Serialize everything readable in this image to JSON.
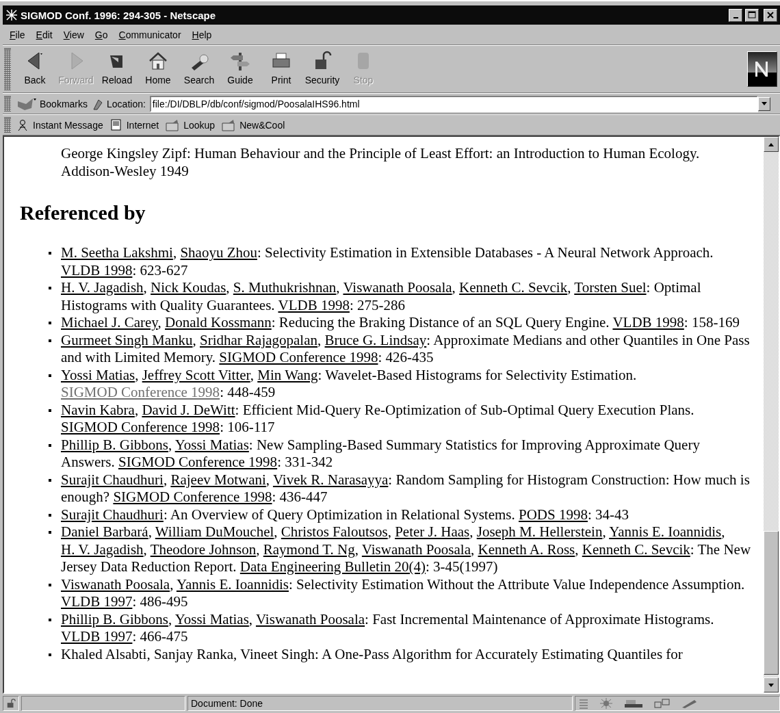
{
  "window": {
    "title": "SIGMOD Conf. 1996: 294-305 - Netscape"
  },
  "menu": [
    "File",
    "Edit",
    "View",
    "Go",
    "Communicator",
    "Help"
  ],
  "toolbar": [
    {
      "label": "Back",
      "kind": "back",
      "disabled": false
    },
    {
      "label": "Forward",
      "kind": "forward",
      "disabled": true
    },
    {
      "label": "Reload",
      "kind": "reload",
      "disabled": false
    },
    {
      "label": "Home",
      "kind": "home",
      "disabled": false
    },
    {
      "label": "Search",
      "kind": "search",
      "disabled": false
    },
    {
      "label": "Guide",
      "kind": "guide",
      "disabled": false
    },
    {
      "label": "Print",
      "kind": "print",
      "disabled": false
    },
    {
      "label": "Security",
      "kind": "security",
      "disabled": false
    },
    {
      "label": "Stop",
      "kind": "stop",
      "disabled": true
    }
  ],
  "location_bar": {
    "bookmarks": "Bookmarks",
    "label": "Location:",
    "value": "file:/DI/DBLP/db/conf/sigmod/PoosalaIHS96.html"
  },
  "personal_toolbar": [
    {
      "label": "Instant Message",
      "kind": "person"
    },
    {
      "label": "Internet",
      "kind": "page"
    },
    {
      "label": "Lookup",
      "kind": "folder"
    },
    {
      "label": "New&Cool",
      "kind": "folder"
    }
  ],
  "content": {
    "previous_reference": "George Kingsley Zipf: Human Behaviour and the Principle of Least Effort: an Introduction to Human Ecology. Addison-Wesley 1949",
    "heading": "Referenced by",
    "entries": [
      [
        {
          "kind": "link",
          "text": "M. Seetha Lakshmi"
        },
        {
          "kind": "text",
          "text": ", "
        },
        {
          "kind": "link",
          "text": "Shaoyu Zhou"
        },
        {
          "kind": "text",
          "text": ": Selectivity Estimation in Extensible Databases - A Neural Network Approach. "
        },
        {
          "kind": "link",
          "text": "VLDB 1998"
        },
        {
          "kind": "text",
          "text": ": 623-627"
        }
      ],
      [
        {
          "kind": "link",
          "text": "H. V. Jagadish"
        },
        {
          "kind": "text",
          "text": ", "
        },
        {
          "kind": "link",
          "text": "Nick Koudas"
        },
        {
          "kind": "text",
          "text": ", "
        },
        {
          "kind": "link",
          "text": "S. Muthukrishnan"
        },
        {
          "kind": "text",
          "text": ", "
        },
        {
          "kind": "link",
          "text": "Viswanath Poosala"
        },
        {
          "kind": "text",
          "text": ", "
        },
        {
          "kind": "link",
          "text": "Kenneth C. Sevcik"
        },
        {
          "kind": "text",
          "text": ", "
        },
        {
          "kind": "link",
          "text": "Torsten Suel"
        },
        {
          "kind": "text",
          "text": ": Optimal Histograms with Quality Guarantees. "
        },
        {
          "kind": "link",
          "text": "VLDB 1998"
        },
        {
          "kind": "text",
          "text": ": 275-286"
        }
      ],
      [
        {
          "kind": "link",
          "text": "Michael J. Carey"
        },
        {
          "kind": "text",
          "text": ", "
        },
        {
          "kind": "link",
          "text": "Donald Kossmann"
        },
        {
          "kind": "text",
          "text": ": Reducing the Braking Distance of an SQL Query Engine. "
        },
        {
          "kind": "link",
          "text": "VLDB 1998"
        },
        {
          "kind": "text",
          "text": ": 158-169"
        }
      ],
      [
        {
          "kind": "link",
          "text": "Gurmeet Singh Manku"
        },
        {
          "kind": "text",
          "text": ", "
        },
        {
          "kind": "link",
          "text": "Sridhar Rajagopalan"
        },
        {
          "kind": "text",
          "text": ", "
        },
        {
          "kind": "link",
          "text": "Bruce G. Lindsay"
        },
        {
          "kind": "text",
          "text": ": Approximate Medians and other Quantiles in One Pass and with Limited Memory. "
        },
        {
          "kind": "link",
          "text": "SIGMOD Conference 1998"
        },
        {
          "kind": "text",
          "text": ": 426-435"
        }
      ],
      [
        {
          "kind": "link",
          "text": "Yossi Matias"
        },
        {
          "kind": "text",
          "text": ", "
        },
        {
          "kind": "link",
          "text": "Jeffrey Scott Vitter"
        },
        {
          "kind": "text",
          "text": ", "
        },
        {
          "kind": "link",
          "text": "Min Wang"
        },
        {
          "kind": "text",
          "text": ": Wavelet-Based Histograms for Selectivity Estimation. "
        },
        {
          "kind": "visited",
          "text": "SIGMOD Conference 1998"
        },
        {
          "kind": "text",
          "text": ": 448-459"
        }
      ],
      [
        {
          "kind": "link",
          "text": "Navin Kabra"
        },
        {
          "kind": "text",
          "text": ", "
        },
        {
          "kind": "link",
          "text": "David J. DeWitt"
        },
        {
          "kind": "text",
          "text": ": Efficient Mid-Query Re-Optimization of Sub-Optimal Query Execution Plans. "
        },
        {
          "kind": "link",
          "text": "SIGMOD Conference 1998"
        },
        {
          "kind": "text",
          "text": ": 106-117"
        }
      ],
      [
        {
          "kind": "link",
          "text": "Phillip B. Gibbons"
        },
        {
          "kind": "text",
          "text": ", "
        },
        {
          "kind": "link",
          "text": "Yossi Matias"
        },
        {
          "kind": "text",
          "text": ": New Sampling-Based Summary Statistics for Improving Approximate Query Answers. "
        },
        {
          "kind": "link",
          "text": "SIGMOD Conference 1998"
        },
        {
          "kind": "text",
          "text": ": 331-342"
        }
      ],
      [
        {
          "kind": "link",
          "text": "Surajit Chaudhuri"
        },
        {
          "kind": "text",
          "text": ", "
        },
        {
          "kind": "link",
          "text": "Rajeev Motwani"
        },
        {
          "kind": "text",
          "text": ", "
        },
        {
          "kind": "link",
          "text": "Vivek R. Narasayya"
        },
        {
          "kind": "text",
          "text": ": Random Sampling for Histogram Construction: How much is enough? "
        },
        {
          "kind": "link",
          "text": "SIGMOD Conference 1998"
        },
        {
          "kind": "text",
          "text": ": 436-447"
        }
      ],
      [
        {
          "kind": "link",
          "text": "Surajit Chaudhuri"
        },
        {
          "kind": "text",
          "text": ": An Overview of Query Optimization in Relational Systems. "
        },
        {
          "kind": "link",
          "text": "PODS 1998"
        },
        {
          "kind": "text",
          "text": ": 34-43"
        }
      ],
      [
        {
          "kind": "link",
          "text": "Daniel Barbará"
        },
        {
          "kind": "text",
          "text": ", "
        },
        {
          "kind": "link",
          "text": "William DuMouchel"
        },
        {
          "kind": "text",
          "text": ", "
        },
        {
          "kind": "link",
          "text": "Christos Faloutsos"
        },
        {
          "kind": "text",
          "text": ", "
        },
        {
          "kind": "link",
          "text": "Peter J. Haas"
        },
        {
          "kind": "text",
          "text": ", "
        },
        {
          "kind": "link",
          "text": "Joseph M. Hellerstein"
        },
        {
          "kind": "text",
          "text": ", "
        },
        {
          "kind": "link",
          "text": "Yannis E. Ioannidis"
        },
        {
          "kind": "text",
          "text": ", "
        },
        {
          "kind": "link",
          "text": "H. V. Jagadish"
        },
        {
          "kind": "text",
          "text": ", "
        },
        {
          "kind": "link",
          "text": "Theodore Johnson"
        },
        {
          "kind": "text",
          "text": ", "
        },
        {
          "kind": "link",
          "text": "Raymond T. Ng"
        },
        {
          "kind": "text",
          "text": ", "
        },
        {
          "kind": "link",
          "text": "Viswanath Poosala"
        },
        {
          "kind": "text",
          "text": ", "
        },
        {
          "kind": "link",
          "text": "Kenneth A. Ross"
        },
        {
          "kind": "text",
          "text": ", "
        },
        {
          "kind": "link",
          "text": "Kenneth C. Sevcik"
        },
        {
          "kind": "text",
          "text": ": The New Jersey Data Reduction Report. "
        },
        {
          "kind": "link",
          "text": "Data Engineering Bulletin 20(4)"
        },
        {
          "kind": "text",
          "text": ": 3-45(1997)"
        }
      ],
      [
        {
          "kind": "link",
          "text": "Viswanath Poosala"
        },
        {
          "kind": "text",
          "text": ", "
        },
        {
          "kind": "link",
          "text": "Yannis E. Ioannidis"
        },
        {
          "kind": "text",
          "text": ": Selectivity Estimation Without the Attribute Value Independence Assumption. "
        },
        {
          "kind": "link",
          "text": "VLDB 1997"
        },
        {
          "kind": "text",
          "text": ": 486-495"
        }
      ],
      [
        {
          "kind": "link",
          "text": "Phillip B. Gibbons"
        },
        {
          "kind": "text",
          "text": ", "
        },
        {
          "kind": "link",
          "text": "Yossi Matias"
        },
        {
          "kind": "text",
          "text": ", "
        },
        {
          "kind": "link",
          "text": "Viswanath Poosala"
        },
        {
          "kind": "text",
          "text": ": Fast Incremental Maintenance of Approximate Histograms. "
        },
        {
          "kind": "link",
          "text": "VLDB 1997"
        },
        {
          "kind": "text",
          "text": ": 466-475"
        }
      ],
      [
        {
          "kind": "text",
          "text": "Khaled Alsabti, Sanjay Ranka, Vineet Singh: A One-Pass Algorithm for Accurately Estimating Quantiles for"
        }
      ]
    ]
  },
  "status_bar": {
    "text": "Document: Done"
  }
}
